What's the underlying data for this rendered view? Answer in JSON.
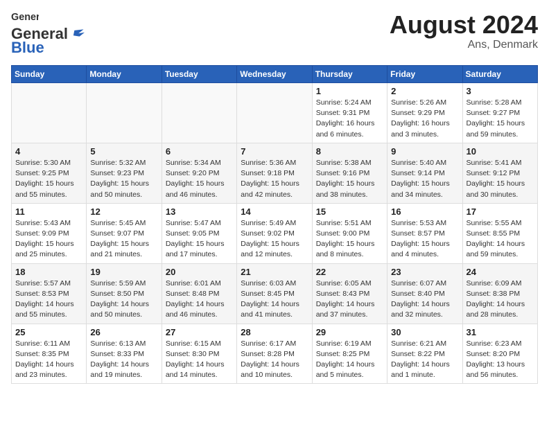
{
  "header": {
    "logo_general": "General",
    "logo_blue": "Blue",
    "month": "August 2024",
    "location": "Ans, Denmark"
  },
  "weekdays": [
    "Sunday",
    "Monday",
    "Tuesday",
    "Wednesday",
    "Thursday",
    "Friday",
    "Saturday"
  ],
  "weeks": [
    [
      {
        "day": "",
        "info": ""
      },
      {
        "day": "",
        "info": ""
      },
      {
        "day": "",
        "info": ""
      },
      {
        "day": "",
        "info": ""
      },
      {
        "day": "1",
        "info": "Sunrise: 5:24 AM\nSunset: 9:31 PM\nDaylight: 16 hours\nand 6 minutes."
      },
      {
        "day": "2",
        "info": "Sunrise: 5:26 AM\nSunset: 9:29 PM\nDaylight: 16 hours\nand 3 minutes."
      },
      {
        "day": "3",
        "info": "Sunrise: 5:28 AM\nSunset: 9:27 PM\nDaylight: 15 hours\nand 59 minutes."
      }
    ],
    [
      {
        "day": "4",
        "info": "Sunrise: 5:30 AM\nSunset: 9:25 PM\nDaylight: 15 hours\nand 55 minutes."
      },
      {
        "day": "5",
        "info": "Sunrise: 5:32 AM\nSunset: 9:23 PM\nDaylight: 15 hours\nand 50 minutes."
      },
      {
        "day": "6",
        "info": "Sunrise: 5:34 AM\nSunset: 9:20 PM\nDaylight: 15 hours\nand 46 minutes."
      },
      {
        "day": "7",
        "info": "Sunrise: 5:36 AM\nSunset: 9:18 PM\nDaylight: 15 hours\nand 42 minutes."
      },
      {
        "day": "8",
        "info": "Sunrise: 5:38 AM\nSunset: 9:16 PM\nDaylight: 15 hours\nand 38 minutes."
      },
      {
        "day": "9",
        "info": "Sunrise: 5:40 AM\nSunset: 9:14 PM\nDaylight: 15 hours\nand 34 minutes."
      },
      {
        "day": "10",
        "info": "Sunrise: 5:41 AM\nSunset: 9:12 PM\nDaylight: 15 hours\nand 30 minutes."
      }
    ],
    [
      {
        "day": "11",
        "info": "Sunrise: 5:43 AM\nSunset: 9:09 PM\nDaylight: 15 hours\nand 25 minutes."
      },
      {
        "day": "12",
        "info": "Sunrise: 5:45 AM\nSunset: 9:07 PM\nDaylight: 15 hours\nand 21 minutes."
      },
      {
        "day": "13",
        "info": "Sunrise: 5:47 AM\nSunset: 9:05 PM\nDaylight: 15 hours\nand 17 minutes."
      },
      {
        "day": "14",
        "info": "Sunrise: 5:49 AM\nSunset: 9:02 PM\nDaylight: 15 hours\nand 12 minutes."
      },
      {
        "day": "15",
        "info": "Sunrise: 5:51 AM\nSunset: 9:00 PM\nDaylight: 15 hours\nand 8 minutes."
      },
      {
        "day": "16",
        "info": "Sunrise: 5:53 AM\nSunset: 8:57 PM\nDaylight: 15 hours\nand 4 minutes."
      },
      {
        "day": "17",
        "info": "Sunrise: 5:55 AM\nSunset: 8:55 PM\nDaylight: 14 hours\nand 59 minutes."
      }
    ],
    [
      {
        "day": "18",
        "info": "Sunrise: 5:57 AM\nSunset: 8:53 PM\nDaylight: 14 hours\nand 55 minutes."
      },
      {
        "day": "19",
        "info": "Sunrise: 5:59 AM\nSunset: 8:50 PM\nDaylight: 14 hours\nand 50 minutes."
      },
      {
        "day": "20",
        "info": "Sunrise: 6:01 AM\nSunset: 8:48 PM\nDaylight: 14 hours\nand 46 minutes."
      },
      {
        "day": "21",
        "info": "Sunrise: 6:03 AM\nSunset: 8:45 PM\nDaylight: 14 hours\nand 41 minutes."
      },
      {
        "day": "22",
        "info": "Sunrise: 6:05 AM\nSunset: 8:43 PM\nDaylight: 14 hours\nand 37 minutes."
      },
      {
        "day": "23",
        "info": "Sunrise: 6:07 AM\nSunset: 8:40 PM\nDaylight: 14 hours\nand 32 minutes."
      },
      {
        "day": "24",
        "info": "Sunrise: 6:09 AM\nSunset: 8:38 PM\nDaylight: 14 hours\nand 28 minutes."
      }
    ],
    [
      {
        "day": "25",
        "info": "Sunrise: 6:11 AM\nSunset: 8:35 PM\nDaylight: 14 hours\nand 23 minutes."
      },
      {
        "day": "26",
        "info": "Sunrise: 6:13 AM\nSunset: 8:33 PM\nDaylight: 14 hours\nand 19 minutes."
      },
      {
        "day": "27",
        "info": "Sunrise: 6:15 AM\nSunset: 8:30 PM\nDaylight: 14 hours\nand 14 minutes."
      },
      {
        "day": "28",
        "info": "Sunrise: 6:17 AM\nSunset: 8:28 PM\nDaylight: 14 hours\nand 10 minutes."
      },
      {
        "day": "29",
        "info": "Sunrise: 6:19 AM\nSunset: 8:25 PM\nDaylight: 14 hours\nand 5 minutes."
      },
      {
        "day": "30",
        "info": "Sunrise: 6:21 AM\nSunset: 8:22 PM\nDaylight: 14 hours\nand 1 minute."
      },
      {
        "day": "31",
        "info": "Sunrise: 6:23 AM\nSunset: 8:20 PM\nDaylight: 13 hours\nand 56 minutes."
      }
    ]
  ]
}
